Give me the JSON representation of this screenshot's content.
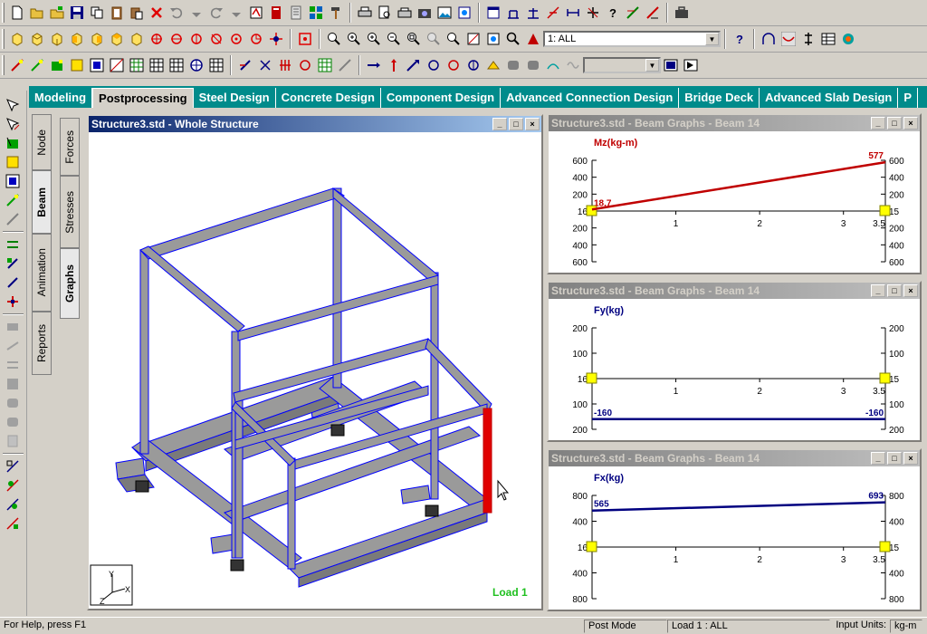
{
  "tabs": [
    "Modeling",
    "Postprocessing",
    "Steel Design",
    "Concrete Design",
    "Component Design",
    "Advanced Connection Design",
    "Bridge Deck",
    "Advanced Slab Design",
    "P"
  ],
  "active_tab": "Postprocessing",
  "load_combo": {
    "value": "1: ALL"
  },
  "side_tabs_outer": [
    "Node",
    "Beam",
    "Animation",
    "Reports"
  ],
  "side_tabs_inner": [
    "Forces",
    "Stresses",
    "Graphs"
  ],
  "main_window": {
    "title": "Structure3.std - Whole Structure",
    "load_label": "Load 1"
  },
  "graphs": [
    {
      "title": "Structure3.std - Beam Graphs - Beam 14",
      "ylabel": "Mz(kg-m)",
      "yticks": [
        "600",
        "400",
        "200",
        "16",
        "200",
        "400",
        "600"
      ],
      "yticks_right": [
        "600",
        "400",
        "200",
        "15",
        "200",
        "400",
        "600"
      ],
      "xticks": [
        "1",
        "2",
        "3",
        "3.5"
      ],
      "scale": 600,
      "line": [
        18.7,
        577
      ],
      "labels": {
        "start": "18.7",
        "end": "577"
      },
      "color": "#c00000"
    },
    {
      "title": "Structure3.std - Beam Graphs - Beam 14",
      "ylabel": "Fy(kg)",
      "yticks": [
        "200",
        "100",
        "16",
        "100",
        "200"
      ],
      "yticks_right": [
        "200",
        "100",
        "15",
        "100",
        "200"
      ],
      "xticks": [
        "1",
        "2",
        "3",
        "3.5"
      ],
      "scale": 200,
      "line": [
        -160,
        -160
      ],
      "labels": {
        "start": "-160",
        "end": "-160"
      },
      "color": "#000080"
    },
    {
      "title": "Structure3.std - Beam Graphs - Beam 14",
      "ylabel": "Fx(kg)",
      "yticks": [
        "800",
        "400",
        "16",
        "400",
        "800"
      ],
      "yticks_right": [
        "800",
        "400",
        "15",
        "400",
        "800"
      ],
      "xticks": [
        "1",
        "2",
        "3",
        "3.5"
      ],
      "scale": 800,
      "line": [
        565,
        693
      ],
      "labels": {
        "start": "565",
        "end": "693"
      },
      "color": "#000080"
    }
  ],
  "status": {
    "help": "For Help, press F1",
    "mode": "Post Mode",
    "load": "Load 1 : ALL",
    "units_label": "Input Units:",
    "units": "kg-m"
  }
}
